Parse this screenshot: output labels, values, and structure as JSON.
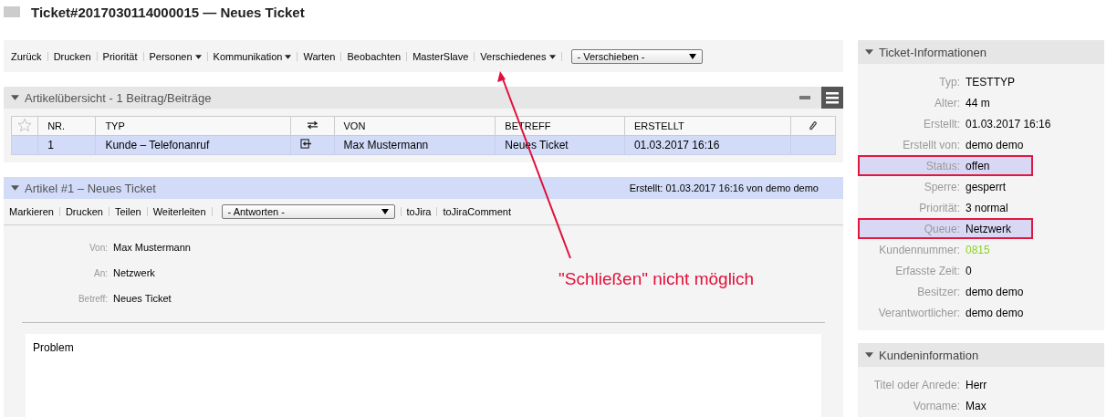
{
  "title": "Ticket#2017030114000015 — Neues Ticket",
  "toolbar": [
    {
      "label": "Zurück",
      "has_menu": false
    },
    {
      "label": "Drucken",
      "has_menu": false
    },
    {
      "label": "Priorität",
      "has_menu": false
    },
    {
      "label": "Personen",
      "has_menu": true
    },
    {
      "label": "Kommunikation",
      "has_menu": true
    },
    {
      "label": "Warten",
      "has_menu": false
    },
    {
      "label": "Beobachten",
      "has_menu": false
    },
    {
      "label": "MasterSlave",
      "has_menu": false
    },
    {
      "label": "Verschiedenes",
      "has_menu": true
    }
  ],
  "move_select": {
    "value": "- Verschieben -"
  },
  "overview": {
    "title": "Artikelübersicht - 1 Beitrag/Beiträge",
    "columns": [
      "NR.",
      "TYP",
      "VON",
      "BETREFF",
      "ERSTELLT"
    ],
    "rows": [
      {
        "selected": true,
        "cells": [
          "1",
          "Kunde – Telefonanruf",
          "Max Mustermann",
          "Neues Ticket",
          "01.03.2017 16:16"
        ]
      }
    ]
  },
  "article": {
    "title": "Artikel #1 – Neues Ticket",
    "created": "Erstellt: 01.03.2017 16:16 von demo demo",
    "actions": [
      "Markieren",
      "Drucken",
      "Teilen",
      "Weiterleiten"
    ],
    "reply_select": {
      "value": "- Antworten -"
    },
    "extra_actions": [
      "toJira",
      "toJiraComment"
    ],
    "fields": [
      {
        "label": "Von:",
        "value": "Max Mustermann"
      },
      {
        "label": "An:",
        "value": "Netzwerk"
      },
      {
        "label": "Betreff:",
        "value": "Neues Ticket"
      }
    ],
    "body": "Problem"
  },
  "annotation": {
    "text": "\"Schließen\" nicht möglich"
  },
  "ticket_info": {
    "title": "Ticket-Informationen",
    "rows": [
      {
        "label": "Typ:",
        "value": "TESTTYP",
        "highlighted": false,
        "kind": "text"
      },
      {
        "label": "Alter:",
        "value": "44 m",
        "highlighted": false,
        "kind": "text"
      },
      {
        "label": "Erstellt:",
        "value": "01.03.2017 16:16",
        "highlighted": false,
        "kind": "text"
      },
      {
        "label": "Erstellt von:",
        "value": "demo demo",
        "highlighted": false,
        "kind": "text"
      },
      {
        "label": "Status:",
        "value": "offen",
        "highlighted": true,
        "kind": "text"
      },
      {
        "label": "Sperre:",
        "value": "gesperrt",
        "highlighted": false,
        "kind": "text"
      },
      {
        "label": "Priorität:",
        "value": "3 normal",
        "highlighted": false,
        "kind": "text"
      },
      {
        "label": "Queue:",
        "value": "Netzwerk",
        "highlighted": true,
        "kind": "text"
      },
      {
        "label": "Kundennummer:",
        "value": "0815",
        "highlighted": false,
        "kind": "link"
      },
      {
        "label": "Erfasste Zeit:",
        "value": "0",
        "highlighted": false,
        "kind": "text"
      },
      {
        "label": "Besitzer:",
        "value": "demo demo",
        "highlighted": false,
        "kind": "text"
      },
      {
        "label": "Verantwortlicher:",
        "value": "demo demo",
        "highlighted": false,
        "kind": "text"
      }
    ]
  },
  "customer_info": {
    "title": "Kundeninformation",
    "rows": [
      {
        "label": "Titel oder Anrede:",
        "value": "Herr"
      },
      {
        "label": "Vorname:",
        "value": "Max"
      }
    ]
  }
}
